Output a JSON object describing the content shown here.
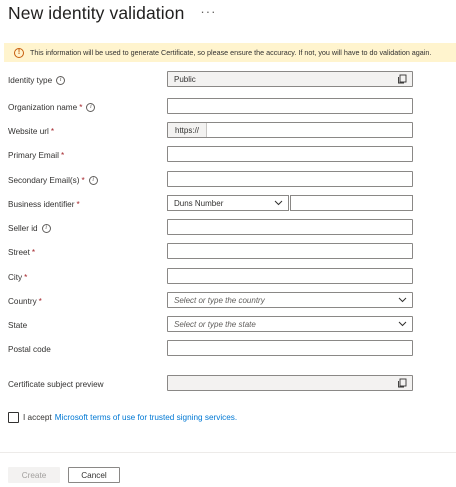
{
  "header": {
    "title": "New identity validation",
    "more": "···"
  },
  "warning": {
    "text": "This information will be used to generate Certificate, so please ensure the accuracy. If not, you will have to do validation again."
  },
  "fields": {
    "identity_type": {
      "label": "Identity type",
      "value": "Public"
    },
    "organization_name": {
      "label": "Organization name",
      "value": ""
    },
    "website_url": {
      "label": "Website url",
      "prefix": "https://",
      "value": ""
    },
    "primary_email": {
      "label": "Primary Email",
      "value": ""
    },
    "secondary_emails": {
      "label": "Secondary Email(s)",
      "value": ""
    },
    "business_identifier": {
      "label": "Business identifier",
      "selected": "Duns Number",
      "value": ""
    },
    "seller_id": {
      "label": "Seller id",
      "value": ""
    },
    "street": {
      "label": "Street",
      "value": ""
    },
    "city": {
      "label": "City",
      "value": ""
    },
    "country": {
      "label": "Country",
      "placeholder": "Select or type the country"
    },
    "state": {
      "label": "State",
      "placeholder": "Select or type the state"
    },
    "postal_code": {
      "label": "Postal code",
      "value": ""
    },
    "certificate_preview": {
      "label": "Certificate subject preview",
      "value": ""
    }
  },
  "required_mark": "*",
  "info_glyph": "i",
  "warning_glyph": "!",
  "accept": {
    "text": "I accept",
    "link": "Microsoft terms of use for trusted signing services."
  },
  "buttons": {
    "create": "Create",
    "cancel": "Cancel"
  },
  "colors": {
    "accent": "#0078d4",
    "required": "#a4262c",
    "warning_bg": "#fff4ce",
    "warning_icon": "#c65c0c"
  },
  "icons": {
    "copy": "copy-icon",
    "chevron": "chevron-down-icon",
    "info": "info-icon",
    "warning": "warning-icon"
  }
}
